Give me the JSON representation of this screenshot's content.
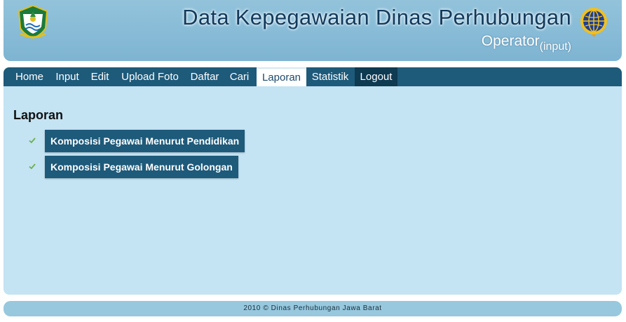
{
  "header": {
    "title": "Data Kepegawaian Dinas Perhubungan",
    "role": "Operator",
    "role_sub": "(input)"
  },
  "nav": {
    "items": [
      {
        "label": "Home"
      },
      {
        "label": "Input"
      },
      {
        "label": "Edit"
      },
      {
        "label": "Upload Foto"
      },
      {
        "label": "Daftar"
      },
      {
        "label": "Cari"
      },
      {
        "label": "Laporan"
      },
      {
        "label": "Statistik"
      },
      {
        "label": "Logout"
      }
    ],
    "active": "Laporan"
  },
  "main": {
    "section_title": "Laporan",
    "reports": [
      {
        "label": "Komposisi Pegawai Menurut Pendidikan"
      },
      {
        "label": "Komposisi Pegawai Menurut Golongan"
      }
    ]
  },
  "footer": {
    "text": "2010 © Dinas Perhubungan Jawa Barat"
  },
  "icons": {
    "left_logo": "west-java-emblem-icon",
    "right_logo": "dishub-emblem-icon",
    "bullet": "check-icon"
  },
  "colors": {
    "header_bg": "#86bad6",
    "nav_bg": "#1e5a7a",
    "content_bg": "#c4e3f3",
    "button_bg": "#1e5a7a",
    "check": "#6ab04c"
  }
}
